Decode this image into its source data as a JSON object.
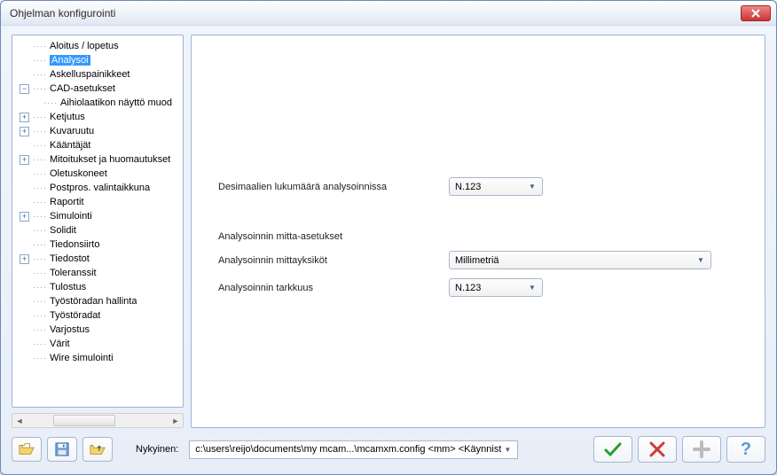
{
  "window": {
    "title": "Ohjelman konfigurointi"
  },
  "tree": {
    "items": [
      {
        "label": "Aloitus / lopetus",
        "expand": null
      },
      {
        "label": "Analysoi",
        "expand": null,
        "selected": true
      },
      {
        "label": "Askelluspainikkeet",
        "expand": null
      },
      {
        "label": "CAD-asetukset",
        "expand": "minus"
      },
      {
        "label": "Aihiolaatikon näyttö muod",
        "expand": null,
        "child": true
      },
      {
        "label": "Ketjutus",
        "expand": "plus"
      },
      {
        "label": "Kuvaruutu",
        "expand": "plus"
      },
      {
        "label": "Kääntäjät",
        "expand": null
      },
      {
        "label": "Mitoitukset ja huomautukset",
        "expand": "plus"
      },
      {
        "label": "Oletuskoneet",
        "expand": null
      },
      {
        "label": "Postpros. valintaikkuna",
        "expand": null
      },
      {
        "label": "Raportit",
        "expand": null
      },
      {
        "label": "Simulointi",
        "expand": "plus"
      },
      {
        "label": "Solidit",
        "expand": null
      },
      {
        "label": "Tiedonsiirto",
        "expand": null
      },
      {
        "label": "Tiedostot",
        "expand": "plus"
      },
      {
        "label": "Toleranssit",
        "expand": null
      },
      {
        "label": "Tulostus",
        "expand": null
      },
      {
        "label": "Työstöradan hallinta",
        "expand": null
      },
      {
        "label": "Työstöradat",
        "expand": null
      },
      {
        "label": "Varjostus",
        "expand": null
      },
      {
        "label": "Värit",
        "expand": null
      },
      {
        "label": "Wire simulointi",
        "expand": null
      }
    ]
  },
  "form": {
    "decimals_label": "Desimaalien lukumäärä analysoinnissa",
    "decimals_value": "N.123",
    "section_title": "Analysoinnin mitta-asetukset",
    "units_label": "Analysoinnin mittayksiköt",
    "units_value": "Millimetriä",
    "precision_label": "Analysoinnin tarkkuus",
    "precision_value": "N.123"
  },
  "footer": {
    "current_label": "Nykyinen:",
    "current_value": "c:\\users\\reijo\\documents\\my mcam...\\mcamxm.config <mm> <Käynnist"
  },
  "icons": {
    "check": "✓",
    "cross": "✖",
    "plus": "＋",
    "help": "?"
  }
}
